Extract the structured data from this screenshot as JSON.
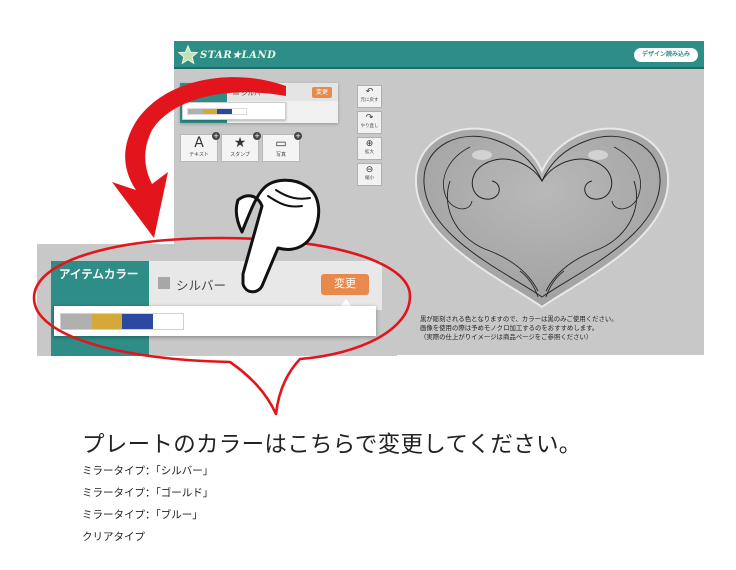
{
  "app": {
    "logo_text": "STAR★LAND",
    "design_button": "デザイン読み込み",
    "colors": {
      "teal": "#2e8d86",
      "orange": "#e8894d",
      "canvas_gray": "#c8c8c8",
      "arrow_red": "#e3151c"
    }
  },
  "item_color": {
    "tab_label": "アイテムカラー",
    "selected_value": "シルバー",
    "change_button": "変更",
    "palette": [
      {
        "name": "silver",
        "hex": "#b0b0b0"
      },
      {
        "name": "gold",
        "hex": "#d4a93a"
      },
      {
        "name": "blue",
        "hex": "#2c48a0"
      },
      {
        "name": "clear",
        "hex": "#ffffff"
      }
    ]
  },
  "tools": [
    {
      "label": "テキスト",
      "icon": "text-a-icon"
    },
    {
      "label": "スタンプ",
      "icon": "star-stamp-icon"
    },
    {
      "label": "写真",
      "icon": "photo-icon"
    }
  ],
  "side_buttons": [
    {
      "label": "元に戻す",
      "icon": "undo-icon"
    },
    {
      "label": "やり直し",
      "icon": "redo-icon"
    },
    {
      "label": "拡大",
      "icon": "zoom-in-icon"
    },
    {
      "label": "縮小",
      "icon": "zoom-out-icon"
    }
  ],
  "canvas_notes": [
    "黒が彫刻される色となりますので、カラーは黒のみご使用ください。",
    "画像を使用の際は予めモノクロ加工するのをおすすめします。",
    "（実際の仕上がりイメージは商品ページをご参照ください）"
  ],
  "headline": "プレートのカラーはこちらで変更してください。",
  "types": [
    "ミラータイプ：「シルバー」",
    "ミラータイプ：「ゴールド」",
    "ミラータイプ：「ブルー」",
    "クリアタイプ"
  ]
}
